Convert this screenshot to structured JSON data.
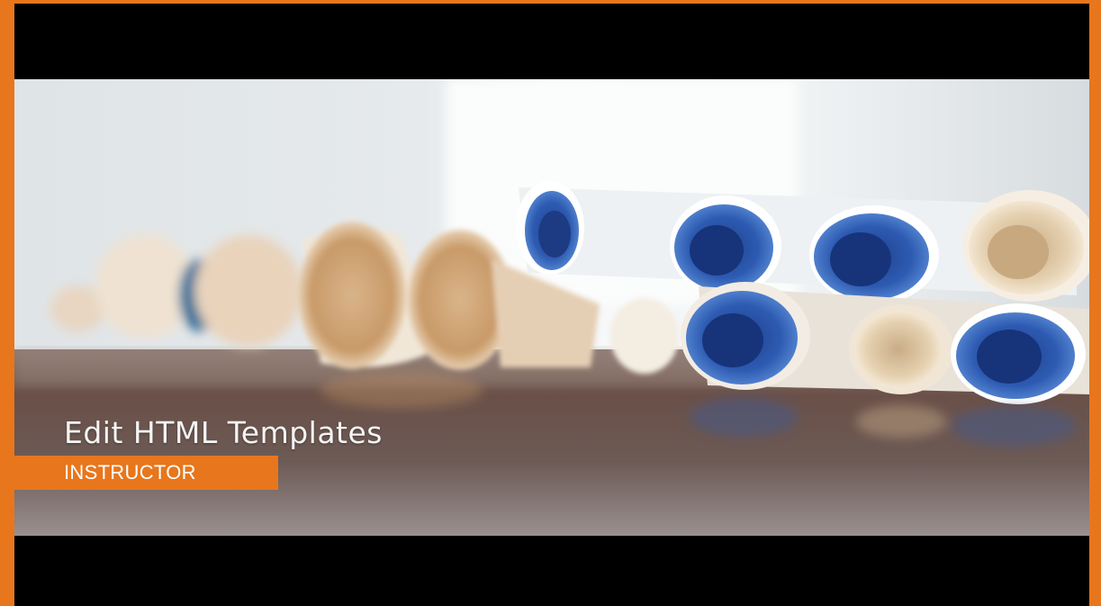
{
  "video": {
    "title": "Edit HTML Templates",
    "badge_label": "INSTRUCTOR"
  },
  "colors": {
    "frame_accent": "#e8761c",
    "letterbox": "#000000",
    "title_text": "#f4f4f4",
    "badge_text": "#ffffff"
  }
}
